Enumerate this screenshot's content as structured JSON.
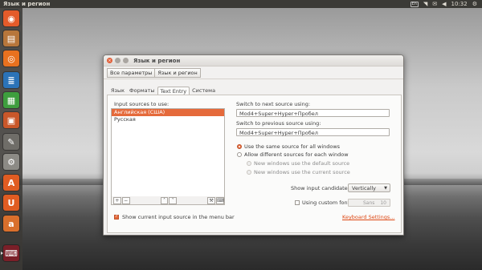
{
  "top_panel": {
    "app_title": "Язык и регион",
    "keyboard_indicator": "En",
    "clock": "10:32"
  },
  "launcher": {
    "items": [
      {
        "name": "dash-icon",
        "color": "#e45b2a",
        "glyph": "◉"
      },
      {
        "name": "files-icon",
        "color": "#b7763b",
        "glyph": "▤"
      },
      {
        "name": "firefox-icon",
        "color": "#e8711f",
        "glyph": "◎"
      },
      {
        "name": "writer-icon",
        "color": "#2b73b8",
        "glyph": "≣"
      },
      {
        "name": "calc-icon",
        "color": "#3e9e3e",
        "glyph": "▦"
      },
      {
        "name": "impress-icon",
        "color": "#c9572a",
        "glyph": "▣"
      },
      {
        "name": "text-editor-icon",
        "color": "#6f6d68",
        "glyph": "✎"
      },
      {
        "name": "settings-icon",
        "color": "#8c8a85",
        "glyph": "⚙"
      },
      {
        "name": "software-center-icon",
        "color": "#e05c22",
        "glyph": "A"
      },
      {
        "name": "ubuntu-one-icon",
        "color": "#e05c22",
        "glyph": "U"
      },
      {
        "name": "amazon-icon",
        "color": "#d96f2c",
        "glyph": "a"
      },
      {
        "name": "keyboard-settings-icon",
        "color": "#7a1f28",
        "glyph": "⌨"
      }
    ]
  },
  "window": {
    "title": "Язык и регион",
    "breadcrumbs": [
      "Все параметры",
      "Язык и регион"
    ],
    "tabs": [
      "Язык",
      "Форматы",
      "Text Entry",
      "Система"
    ],
    "active_tab": "Text Entry",
    "input_sources_label": "Input sources to use:",
    "input_sources": [
      "Английская (США)",
      "Русская"
    ],
    "selected_source": "Английская (США)",
    "list_buttons": [
      "+",
      "−",
      "˄",
      "˅",
      "⚒",
      "⌨"
    ],
    "next_source_label": "Switch to next source using:",
    "next_source_value": "Mod4+Super+Hyper+Пробел",
    "prev_source_label": "Switch to previous source using:",
    "prev_source_value": "Mod4+Super+Hyper+Пробел",
    "radio_same": "Use the same source for all windows",
    "radio_different": "Allow different sources for each window",
    "sub_default": "New windows use the default source",
    "sub_current": "New windows use the current source",
    "candidates_label": "Show input candidates:",
    "candidates_value": "Vertically",
    "custom_font_label": "Using custom font:",
    "font_name": "Sans",
    "font_size": "10",
    "show_source_label": "Show current input source in the menu bar",
    "keyboard_settings_link": "Keyboard Settings..."
  },
  "colors": {
    "accent": "#e56a3b",
    "panel": "#3b3a36",
    "link": "#dd4814"
  }
}
